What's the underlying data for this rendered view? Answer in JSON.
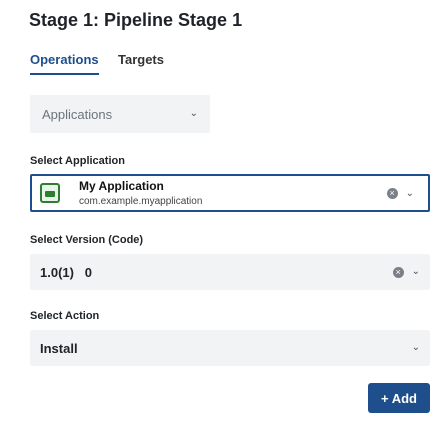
{
  "header": {
    "title": "Stage 1: Pipeline Stage 1"
  },
  "tabs": [
    {
      "label": "Operations",
      "active": true
    },
    {
      "label": "Targets",
      "active": false
    }
  ],
  "filter": {
    "value": "Applications"
  },
  "select_application": {
    "label": "Select Application",
    "selected": {
      "name": "My Application",
      "package": "com.example.myapplication"
    }
  },
  "select_version": {
    "label": "Select Version (Code)",
    "value": "1.0(1)   0"
  },
  "select_action": {
    "label": "Select Action",
    "value": "Install"
  },
  "add_button": {
    "label": "+ Add"
  },
  "colors": {
    "accent": "#1e4f8c",
    "field_bg": "#f1f3f5",
    "app_icon": "#2f7d32"
  },
  "icons": {
    "clear": "circle-x-icon",
    "dropdown": "chevron-down-icon",
    "app": "android-app-icon"
  }
}
